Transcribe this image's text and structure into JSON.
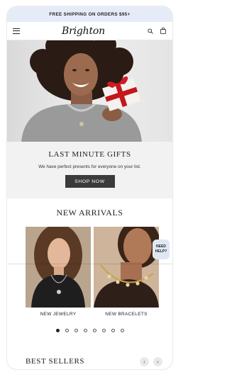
{
  "promo": {
    "text": "FREE SHIPPING ON ORDERS $95+"
  },
  "header": {
    "logo": "Brighton",
    "menu_icon": "hamburger-menu-icon",
    "search_icon": "search-icon",
    "bag_icon": "shopping-bag-icon"
  },
  "hero": {
    "alt": "Woman holding gift box"
  },
  "gift_banner": {
    "title": "LAST MINUTE GIFTS",
    "subtitle": "We have perfect presents for everyone on your list.",
    "cta": "SHOP NOW"
  },
  "new_arrivals": {
    "title": "NEW ARRIVALS",
    "items": [
      {
        "label": "NEW JEWELRY"
      },
      {
        "label": "NEW BRACELETS"
      }
    ],
    "dots_total": 8,
    "dots_active": 0
  },
  "help_widget": {
    "line1": "NEED",
    "line2": "HELP?"
  },
  "best_sellers": {
    "title": "BEST SELLERS",
    "prev_icon": "chevron-left-icon",
    "next_icon": "chevron-right-icon"
  },
  "colors": {
    "promo_bg": "#e6ecf7",
    "button_bg": "#3b3b3b",
    "panel_bg": "#f2f2f2"
  }
}
